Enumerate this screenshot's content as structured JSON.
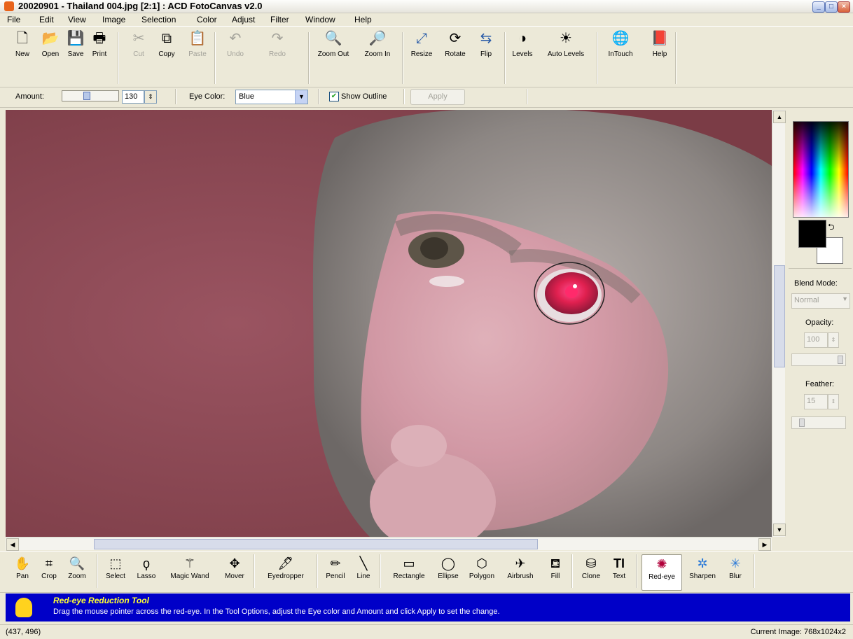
{
  "window": {
    "title": "20020901 - Thailand 004.jpg [2:1] : ACD FotoCanvas v2.0",
    "minimize_icon": "minimize-icon",
    "maximize_icon": "maximize-icon",
    "close_icon": "close-icon"
  },
  "menu": [
    "File",
    "Edit",
    "View",
    "Image",
    "Selection",
    "Color",
    "Adjust",
    "Filter",
    "Window",
    "Help"
  ],
  "toolbar": {
    "new": "New",
    "open": "Open",
    "save": "Save",
    "print": "Print",
    "cut": "Cut",
    "copy": "Copy",
    "paste": "Paste",
    "undo": "Undo",
    "redo": "Redo",
    "zoom_out": "Zoom Out",
    "zoom_in": "Zoom In",
    "resize": "Resize",
    "rotate": "Rotate",
    "flip": "Flip",
    "levels": "Levels",
    "auto_levels": "Auto Levels",
    "intouch": "InTouch",
    "help": "Help"
  },
  "options": {
    "amount_label": "Amount:",
    "amount_value": "130",
    "amount_slider_fraction": 0.43,
    "eye_color_label": "Eye Color:",
    "eye_color_value": "Blue",
    "show_outline_label": "Show Outline",
    "show_outline_checked": true,
    "apply_label": "Apply"
  },
  "right_panel": {
    "blend_mode_label": "Blend Mode:",
    "blend_mode_value": "Normal",
    "opacity_label": "Opacity:",
    "opacity_value": "100",
    "feather_label": "Feather:",
    "feather_value": "15",
    "foreground_color": "#000000",
    "background_color": "#ffffff"
  },
  "tools": {
    "pan": "Pan",
    "crop": "Crop",
    "zoom": "Zoom",
    "select": "Select",
    "lasso": "Lasso",
    "magic_wand": "Magic Wand",
    "mover": "Mover",
    "eyedropper": "Eyedropper",
    "pencil": "Pencil",
    "line": "Line",
    "rectangle": "Rectangle",
    "ellipse": "Ellipse",
    "polygon": "Polygon",
    "airbrush": "Airbrush",
    "fill": "Fill",
    "clone": "Clone",
    "text": "Text",
    "red_eye": "Red-eye",
    "sharpen": "Sharpen",
    "blur": "Blur"
  },
  "hint": {
    "title": "Red-eye Reduction Tool",
    "text": "Drag the mouse pointer across the red-eye.  In the Tool Options, adjust the Eye color and Amount and click Apply to set the change."
  },
  "status": {
    "coords": "(437, 496)",
    "image_info": "Current Image: 768x1024x2"
  }
}
